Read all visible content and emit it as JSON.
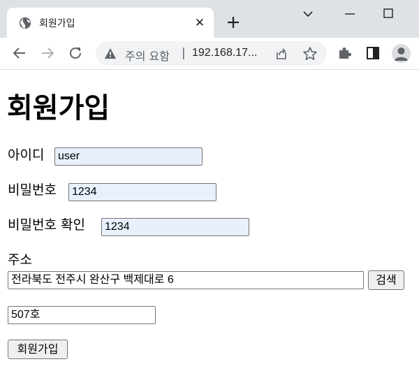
{
  "browser": {
    "tab_title": "회원가입",
    "close_glyph": "✕",
    "security_text": "주의 요함",
    "separator": "|",
    "url": "192.168.17..."
  },
  "page": {
    "title": "회원가입",
    "id_label": "아이디",
    "id_value": "user",
    "pw_label": "비밀번호",
    "pw_value": "1234",
    "pw_confirm_label": "비밀번호 확인",
    "pw_confirm_value": "1234",
    "address_label": "주소",
    "address_value": "전라북도 전주시 완산구 백제대로 6",
    "search_button": "검색",
    "address_detail_value": "507호",
    "submit_button": "회원가입"
  },
  "colors": {
    "chrome_bg": "#dee1e6",
    "omnibox_bg": "#f1f3f4",
    "autofill_bg": "#e8f0fe"
  }
}
